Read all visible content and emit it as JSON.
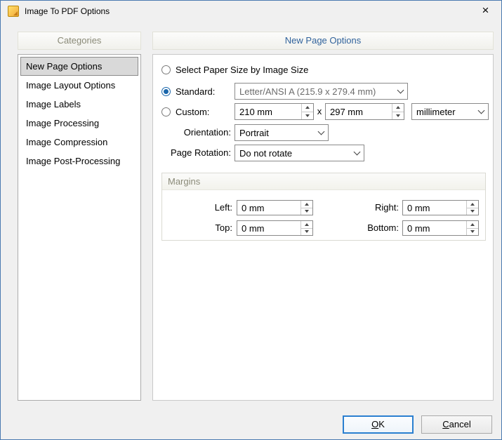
{
  "window": {
    "title": "Image To PDF Options",
    "close_glyph": "×"
  },
  "categories": {
    "header": "Categories",
    "items": [
      {
        "label": "New Page Options",
        "selected": true
      },
      {
        "label": "Image Layout Options",
        "selected": false
      },
      {
        "label": "Image Labels",
        "selected": false
      },
      {
        "label": "Image Processing",
        "selected": false
      },
      {
        "label": "Image Compression",
        "selected": false
      },
      {
        "label": "Image Post-Processing",
        "selected": false
      }
    ]
  },
  "options": {
    "header": "New Page Options",
    "by_image_size_label": "Select Paper Size by Image Size",
    "standard_label": "Standard:",
    "standard_value": "Letter/ANSI A (215.9 x 279.4 mm)",
    "custom_label": "Custom:",
    "custom_width": "210 mm",
    "separator": "x",
    "custom_height": "297 mm",
    "unit_value": "millimeter",
    "orientation_label": "Orientation:",
    "orientation_value": "Portrait",
    "rotation_label": "Page Rotation:",
    "rotation_value": "Do not rotate"
  },
  "margins": {
    "header": "Margins",
    "left_label": "Left:",
    "left_value": "0 mm",
    "right_label": "Right:",
    "right_value": "0 mm",
    "top_label": "Top:",
    "top_value": "0 mm",
    "bottom_label": "Bottom:",
    "bottom_value": "0 mm"
  },
  "footer": {
    "ok_label": "OK",
    "cancel_label": "Cancel"
  }
}
